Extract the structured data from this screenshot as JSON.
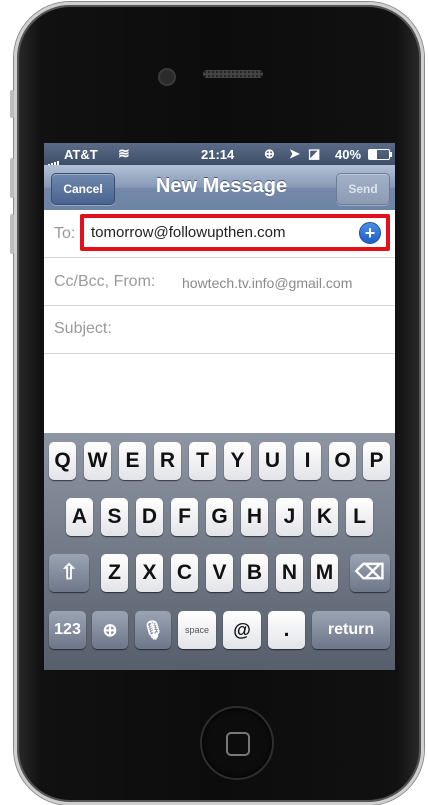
{
  "status_bar": {
    "carrier": "AT&T",
    "time": "21:14",
    "battery": "40%"
  },
  "nav": {
    "cancel_label": "Cancel",
    "title": "New Message",
    "send_label": "Send"
  },
  "compose": {
    "to_label": "To:",
    "to_value": "tomorrow@followupthen.com",
    "ccbcc_label": "Cc/Bcc, From:",
    "from_value": "howtech.tv.info@gmail.com",
    "subject_label": "Subject:"
  },
  "keyboard": {
    "row1": [
      "Q",
      "W",
      "E",
      "R",
      "T",
      "Y",
      "U",
      "I",
      "O",
      "P"
    ],
    "row2": [
      "A",
      "S",
      "D",
      "F",
      "G",
      "H",
      "J",
      "K",
      "L"
    ],
    "row3": [
      "Z",
      "X",
      "C",
      "V",
      "B",
      "N",
      "M"
    ],
    "numbers_label": "123",
    "space_label": "space",
    "at_label": "@",
    "dot_label": ".",
    "return_label": "return"
  },
  "colors": {
    "highlight": "#e2101a",
    "nav_blue": "#6d84a5"
  }
}
